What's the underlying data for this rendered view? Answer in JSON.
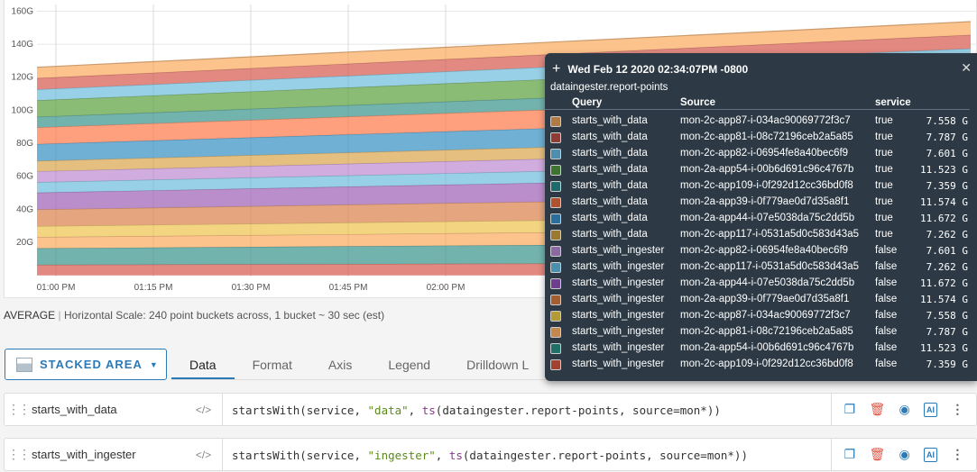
{
  "chart_data": {
    "type": "area",
    "stacked": true,
    "x": [
      "12:57 PM",
      "02:34 PM"
    ],
    "xticks": [
      "01:00 PM",
      "01:15 PM",
      "01:30 PM",
      "01:45 PM",
      "02:00 PM"
    ],
    "yticks": [
      "20G",
      "40G",
      "60G",
      "80G",
      "100G",
      "120G",
      "140G",
      "160G"
    ],
    "ylim": [
      0,
      160
    ],
    "grid": true,
    "series_bottom_to_top": [
      {
        "values": [
          6.4,
          7.359
        ],
        "fill": "#e0837a"
      },
      {
        "values": [
          10.0,
          11.523
        ],
        "fill": "#6aafa9"
      },
      {
        "values": [
          6.8,
          7.787
        ],
        "fill": "#fdc087"
      },
      {
        "values": [
          6.6,
          7.558
        ],
        "fill": "#f2d27a"
      },
      {
        "values": [
          10.1,
          11.574
        ],
        "fill": "#e4a078"
      },
      {
        "values": [
          10.2,
          11.672
        ],
        "fill": "#b688c8"
      },
      {
        "values": [
          6.3,
          7.262
        ],
        "fill": "#92cde6"
      },
      {
        "values": [
          6.6,
          7.601
        ],
        "fill": "#cfa8dc"
      },
      {
        "values": [
          6.3,
          7.262
        ],
        "fill": "#e4bc78"
      },
      {
        "values": [
          10.2,
          11.672
        ],
        "fill": "#68acd3"
      },
      {
        "values": [
          10.1,
          11.574
        ],
        "fill": "#fe9a76"
      },
      {
        "values": [
          6.4,
          7.359
        ],
        "fill": "#6aafa9"
      },
      {
        "values": [
          10.0,
          11.523
        ],
        "fill": "#84b86e"
      },
      {
        "values": [
          6.6,
          7.601
        ],
        "fill": "#92cde6"
      },
      {
        "values": [
          6.8,
          7.787
        ],
        "fill": "#e0837a"
      },
      {
        "values": [
          6.6,
          7.558
        ],
        "fill": "#fdc087"
      }
    ]
  },
  "summary": {
    "agg": "AVERAGE",
    "text": "Horizontal Scale: 240 point buckets across, 1 bucket ~ 30 sec (est)"
  },
  "chart_type_button": "STACKED AREA",
  "tabs": [
    "Data",
    "Format",
    "Axis",
    "Legend",
    "Drilldown L"
  ],
  "queries": [
    {
      "name": "starts_with_data",
      "expr_pre": "startsWith(service, ",
      "expr_str": "\"data\"",
      "expr_mid": ", ",
      "expr_fn": "ts",
      "expr_post": "(dataingester.report-points, source=mon*))"
    },
    {
      "name": "starts_with_ingester",
      "expr_pre": "startsWith(service, ",
      "expr_str": "\"ingester\"",
      "expr_mid": ", ",
      "expr_fn": "ts",
      "expr_post": "(dataingester.report-points, source=mon*))"
    }
  ],
  "tooltip": {
    "timestamp": "Wed Feb 12 2020 02:34:07PM -0800",
    "metric": "dataingester.report-points",
    "columns": [
      "Query",
      "Source",
      "service"
    ],
    "rows": [
      {
        "query": "starts_with_data",
        "source": "mon-2c-app87-i-034ac90069772f3c7",
        "service": "true",
        "value": "7.558 G",
        "color": "#b07a45"
      },
      {
        "query": "starts_with_data",
        "source": "mon-2c-app81-i-08c72196ceb2a5a85",
        "service": "true",
        "value": "7.787 G",
        "color": "#903c36"
      },
      {
        "query": "starts_with_data",
        "source": "mon-2c-app82-i-06954fe8a40bec6f9",
        "service": "true",
        "value": "7.601 G",
        "color": "#4f8fae"
      },
      {
        "query": "starts_with_data",
        "source": "mon-2a-app54-i-00b6d691c96c4767b",
        "service": "true",
        "value": "11.523 G",
        "color": "#3e7430"
      },
      {
        "query": "starts_with_data",
        "source": "mon-2c-app109-i-0f292d12cc36bd0f8",
        "service": "true",
        "value": "7.359 G",
        "color": "#1f6a6a"
      },
      {
        "query": "starts_with_data",
        "source": "mon-2a-app39-i-0f779ae0d7d35a8f1",
        "service": "true",
        "value": "11.574 G",
        "color": "#b0522f"
      },
      {
        "query": "starts_with_data",
        "source": "mon-2a-app44-i-07e5038da75c2dd5b",
        "service": "true",
        "value": "11.672 G",
        "color": "#2a6e9a"
      },
      {
        "query": "starts_with_data",
        "source": "mon-2c-app117-i-0531a5d0c583d43a5",
        "service": "true",
        "value": "7.262 G",
        "color": "#9a7a30"
      },
      {
        "query": "starts_with_ingester",
        "source": "mon-2c-app82-i-06954fe8a40bec6f9",
        "service": "false",
        "value": "7.601 G",
        "color": "#8b6aa2"
      },
      {
        "query": "starts_with_ingester",
        "source": "mon-2c-app117-i-0531a5d0c583d43a5",
        "service": "false",
        "value": "7.262 G",
        "color": "#4a8fab"
      },
      {
        "query": "starts_with_ingester",
        "source": "mon-2a-app44-i-07e5038da75c2dd5b",
        "service": "false",
        "value": "11.672 G",
        "color": "#6e3f8e"
      },
      {
        "query": "starts_with_ingester",
        "source": "mon-2a-app39-i-0f779ae0d7d35a8f1",
        "service": "false",
        "value": "11.574 G",
        "color": "#a35e32"
      },
      {
        "query": "starts_with_ingester",
        "source": "mon-2c-app87-i-034ac90069772f3c7",
        "service": "false",
        "value": "7.558 G",
        "color": "#b49a35"
      },
      {
        "query": "starts_with_ingester",
        "source": "mon-2c-app81-i-08c72196ceb2a5a85",
        "service": "false",
        "value": "7.787 G",
        "color": "#c4874e"
      },
      {
        "query": "starts_with_ingester",
        "source": "mon-2a-app54-i-00b6d691c96c4767b",
        "service": "false",
        "value": "11.523 G",
        "color": "#20706a"
      },
      {
        "query": "starts_with_ingester",
        "source": "mon-2c-app109-i-0f292d12cc36bd0f8",
        "service": "false",
        "value": "7.359 G",
        "color": "#a2412f"
      }
    ]
  },
  "accent": "#2a7ab8"
}
